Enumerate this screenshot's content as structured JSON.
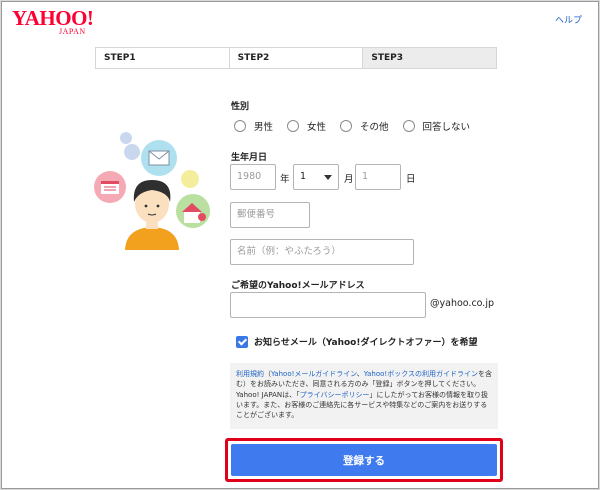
{
  "header": {
    "logo_main": "YAHOO!",
    "logo_sub": "JAPAN",
    "help_link": "ヘルプ"
  },
  "steps": [
    "STEP1",
    "STEP2",
    "STEP3"
  ],
  "form": {
    "gender": {
      "label": "性別",
      "options": [
        "男性",
        "女性",
        "その他",
        "回答しない"
      ]
    },
    "birthdate": {
      "label": "生年月日",
      "year_placeholder": "1980",
      "year_unit": "年",
      "month_value": "1",
      "month_unit": "月",
      "day_placeholder": "1",
      "day_unit": "日"
    },
    "postal_placeholder": "郵便番号",
    "name_placeholder": "名前（例：やふたろう）",
    "email": {
      "label": "ご希望のYahoo!メールアドレス",
      "suffix": "@yahoo.co.jp"
    },
    "newsletter_label": "お知らせメール（Yahoo!ダイレクトオファー）を希望",
    "terms": {
      "link1": "利用規約",
      "t1": "（",
      "link2": "Yahoo!メールガイドライン",
      "t2": "、",
      "link3": "Yahoo!ボックスの利用ガイドライン",
      "t3": "を含む）をお読みいただき、同意される方のみ「登録」ボタンを押してください。Yahoo! JAPANは、「",
      "link4": "プライバシーポリシー",
      "t4": "」にしたがってお客様の情報を取り扱います。また、お客様のご連絡先に各サービスや特集などのご案内をお送りすることがございます。"
    },
    "submit_label": "登録する"
  },
  "colors": {
    "brand_red": "#ff0033",
    "link_blue": "#1e63c4",
    "primary_button": "#3f7bef",
    "highlight_border": "#e0001a"
  }
}
